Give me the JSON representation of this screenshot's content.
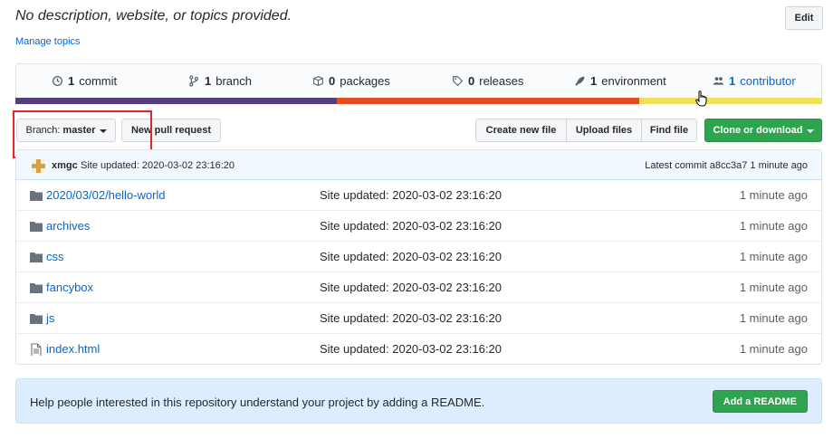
{
  "repo": {
    "description": "No description, website, or topics provided.",
    "manage_topics": "Manage topics",
    "edit_label": "Edit"
  },
  "stats": [
    {
      "count": "1",
      "label": "commit",
      "icon": "history-icon"
    },
    {
      "count": "1",
      "label": "branch",
      "icon": "branch-icon"
    },
    {
      "count": "0",
      "label": "packages",
      "icon": "package-icon"
    },
    {
      "count": "0",
      "label": "releases",
      "icon": "tag-icon"
    },
    {
      "count": "1",
      "label": "environment",
      "icon": "rocket-icon"
    },
    {
      "count": "1",
      "label": "contributor",
      "icon": "people-icon"
    }
  ],
  "language_colors": [
    "#563d7c",
    "#e34c26",
    "#f1e05a"
  ],
  "language_shares": [
    0.398,
    0.375,
    0.227
  ],
  "toolbar": {
    "branch_prefix": "Branch:",
    "branch_name": "master",
    "new_pull_request": "New pull request",
    "create_new_file": "Create new file",
    "upload_files": "Upload files",
    "find_file": "Find file",
    "clone_or_download": "Clone or download"
  },
  "latest_commit": {
    "author": "xmgc",
    "message": "Site updated: 2020-03-02 23:16:20",
    "prefix": "Latest commit",
    "sha": "a8cc3a7",
    "age": "1 minute ago"
  },
  "files": [
    {
      "type": "dir",
      "name": "2020/03/02/hello-world",
      "message": "Site updated: 2020-03-02 23:16:20",
      "age": "1 minute ago"
    },
    {
      "type": "dir",
      "name": "archives",
      "message": "Site updated: 2020-03-02 23:16:20",
      "age": "1 minute ago"
    },
    {
      "type": "dir",
      "name": "css",
      "message": "Site updated: 2020-03-02 23:16:20",
      "age": "1 minute ago"
    },
    {
      "type": "dir",
      "name": "fancybox",
      "message": "Site updated: 2020-03-02 23:16:20",
      "age": "1 minute ago"
    },
    {
      "type": "dir",
      "name": "js",
      "message": "Site updated: 2020-03-02 23:16:20",
      "age": "1 minute ago"
    },
    {
      "type": "file",
      "name": "index.html",
      "message": "Site updated: 2020-03-02 23:16:20",
      "age": "1 minute ago"
    }
  ],
  "readme": {
    "text": "Help people interested in this repository understand your project by adding a README.",
    "button": "Add a README"
  },
  "colors": {
    "accent_link": "#0366d6",
    "green": "#2ea44f",
    "highlight_border": "#e0262b"
  }
}
